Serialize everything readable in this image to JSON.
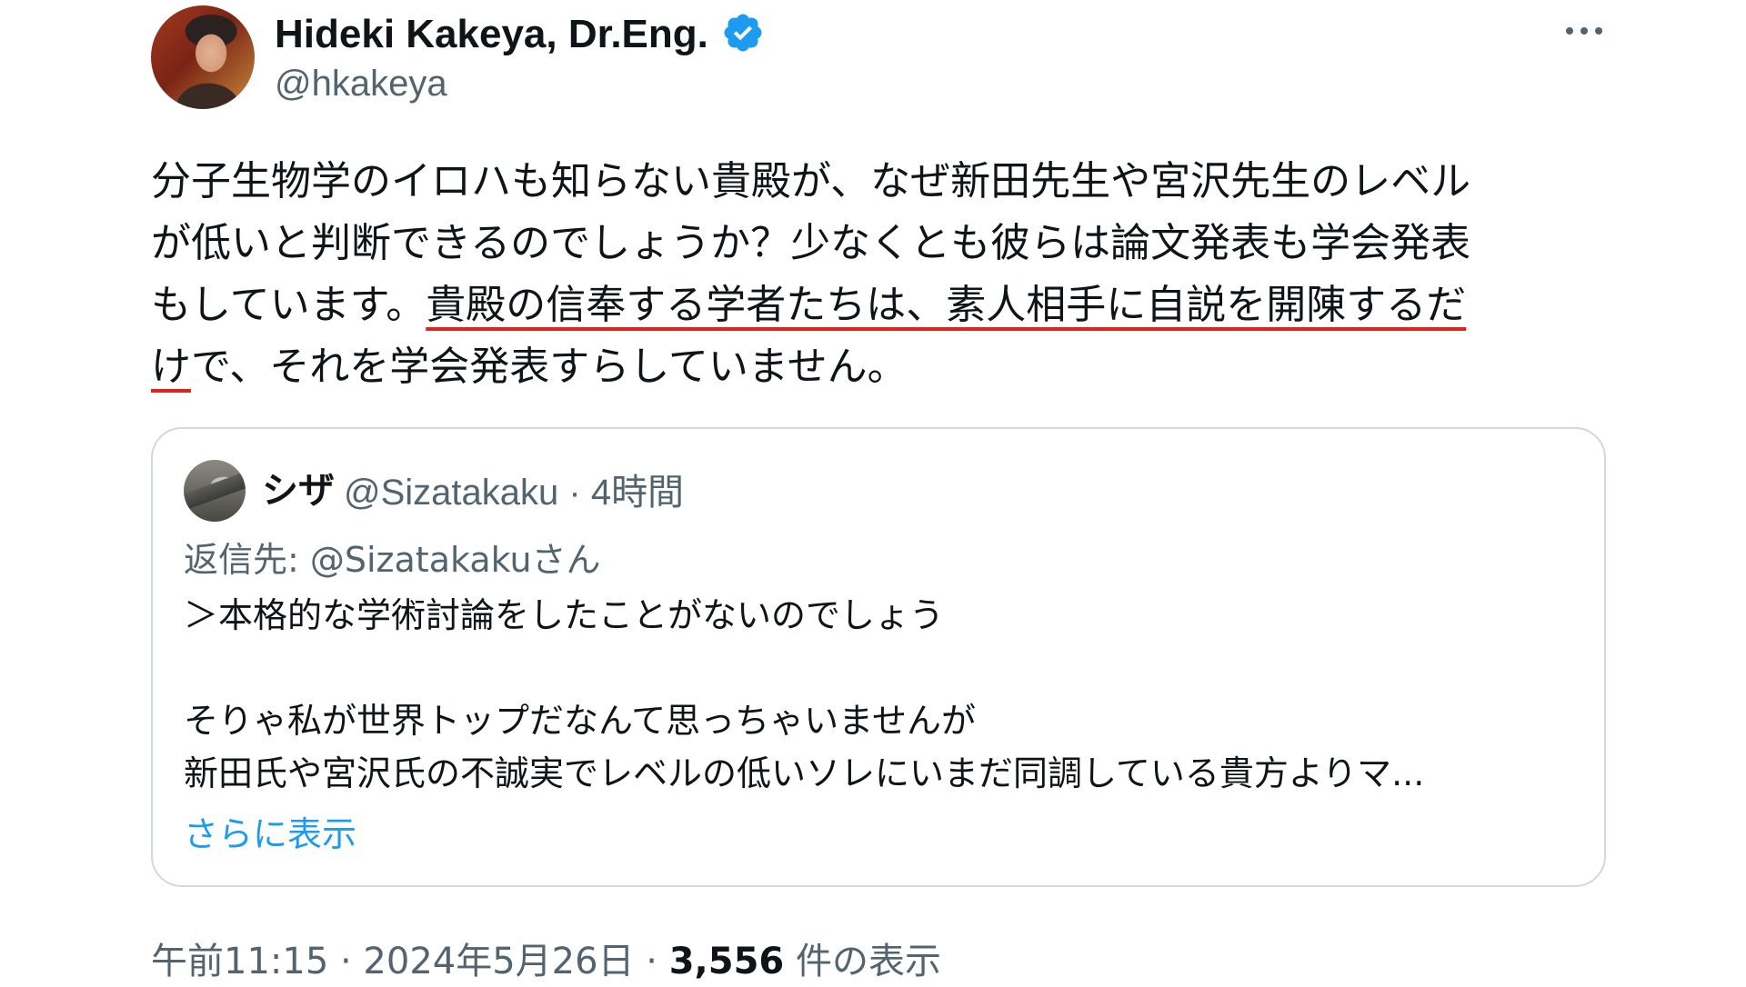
{
  "author": {
    "display_name": "Hideki Kakeya, Dr.Eng.",
    "handle": "@hkakeya",
    "verified_color": "#1d9bf0"
  },
  "tweet": {
    "lines": [
      "分子生物学のイロハも知らない貴殿が、なぜ新田先生や宮沢先生のレベル",
      "が低いと判断できるのでしょうか？少なくとも彼らは論文発表も学会発表",
      "もしています。",
      "貴殿の信奉する学者たちは、素人相手に自説を開陳するだ",
      "け",
      "で、それを学会発表すらしていません。"
    ],
    "underline_color": "#e0241b"
  },
  "quote": {
    "name": "シザ",
    "meta": "@Sizatakaku · 4時間",
    "reply_to": "返信先: @Sizatakakuさん",
    "lines": [
      "＞本格的な学術討論をしたことがないのでしょう",
      "そりゃ私が世界トップだなんて思っちゃいませんが",
      "新田氏や宮沢氏の不誠実でレベルの低いソレにいまだ同調している貴方よりマ..."
    ],
    "show_more": "さらに表示"
  },
  "footer": {
    "time_date": "午前11:15 · 2024年5月26日 · ",
    "views_count": "3,556",
    "views_label": " 件の表示"
  },
  "icons": {
    "verified": "verified-badge-icon",
    "more": "more-horizontal-icon"
  }
}
